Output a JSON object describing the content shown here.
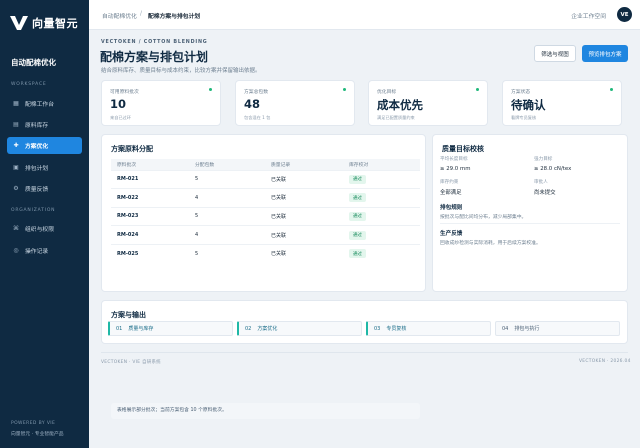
{
  "brand": {
    "name": "向量智元",
    "logo_letter": "V"
  },
  "sidebar": {
    "app_title": "自动配棉优化",
    "workspace_label": "WORKSPACE",
    "organization_label": "ORGANIZATION",
    "items": [
      {
        "label": "配棉工作台",
        "icon": "grid-icon"
      },
      {
        "label": "原料库存",
        "icon": "list-icon"
      },
      {
        "label": "方案优化",
        "icon": "plus-icon",
        "active": true
      },
      {
        "label": "排包计划",
        "icon": "calendar-icon"
      },
      {
        "label": "质量反馈",
        "icon": "gear-icon"
      },
      {
        "label": "组织与权限",
        "icon": "users-icon"
      },
      {
        "label": "操作记录",
        "icon": "history-icon"
      }
    ],
    "powered_by": "POWERED BY VIE",
    "powered_sub": "向量智元 · 专业智能产品"
  },
  "topbar": {
    "breadcrumb": [
      "自动配棉优化",
      "配棉方案与排包计划"
    ],
    "breadcrumb_sep": "/",
    "workspace": "企业工作空间",
    "avatar": "VE"
  },
  "header": {
    "eyebrow": "VECTOKEN / COTTON BLENDING",
    "title": "配棉方案与排包计划",
    "subtitle": "结合原料库存、质量目标与成本约束，比较方案并保留输出依据。",
    "secondary_button": "筛选与视图",
    "primary_button": "预览排包方案"
  },
  "stats": [
    {
      "label": "可用原料批次",
      "value": "10",
      "note": "来自已过环"
    },
    {
      "label": "方案总包数",
      "value": "48",
      "note": "包含混在 1 包"
    },
    {
      "label": "优化目标",
      "value": "成本优先",
      "note": "满足已配置质量约束"
    },
    {
      "label": "方案状态",
      "value": "待确认",
      "note": "看牌专员复核"
    }
  ],
  "materials": {
    "title": "方案原料分配",
    "columns": [
      "原料批次",
      "分配包数",
      "质量记录",
      "库存校对"
    ],
    "rows": [
      {
        "code": "RM-021",
        "bags": "5",
        "quality": "已关联",
        "status": "通过"
      },
      {
        "code": "RM-022",
        "bags": "4",
        "quality": "已关联",
        "status": "通过"
      },
      {
        "code": "RM-023",
        "bags": "5",
        "quality": "已关联",
        "status": "通过"
      },
      {
        "code": "RM-024",
        "bags": "4",
        "quality": "已关联",
        "status": "通过"
      },
      {
        "code": "RM-025",
        "bags": "5",
        "quality": "已关联",
        "status": "通过"
      }
    ],
    "note": "表格展示部分批次；当前方案包含 10 个原料批次。"
  },
  "quality": {
    "title": "质量目标校核",
    "fields": [
      {
        "label": "平均长度目标",
        "value": "≥ 29.0 mm"
      },
      {
        "label": "强力目标",
        "value": "≥ 28.0 cN/tex"
      },
      {
        "label": "库存约束",
        "value": "全部满足"
      },
      {
        "label": "审批人",
        "value": "尚未提交"
      }
    ],
    "rule_title": "排包规则",
    "rule_text": "按批次与配比间均分布，减少局部集中。",
    "feedback_title": "生产反馈",
    "feedback_text": "回收成纱检测与实际消耗，用于后续方案校准。"
  },
  "output": {
    "title": "方案与输出",
    "steps": [
      {
        "num": "01",
        "label": "质量与库存",
        "done": true
      },
      {
        "num": "02",
        "label": "方案优化",
        "done": true
      },
      {
        "num": "03",
        "label": "专员复核",
        "done": true
      },
      {
        "num": "04",
        "label": "排包与执行",
        "done": false
      }
    ]
  },
  "footer": {
    "left": "VECTOKEN · VIE 自研系统",
    "right": "VECTOKEN · 2026.04"
  },
  "colors": {
    "accent": "#1f86e0",
    "sidebar": "#0f2a42",
    "success": "#1fb87a"
  }
}
